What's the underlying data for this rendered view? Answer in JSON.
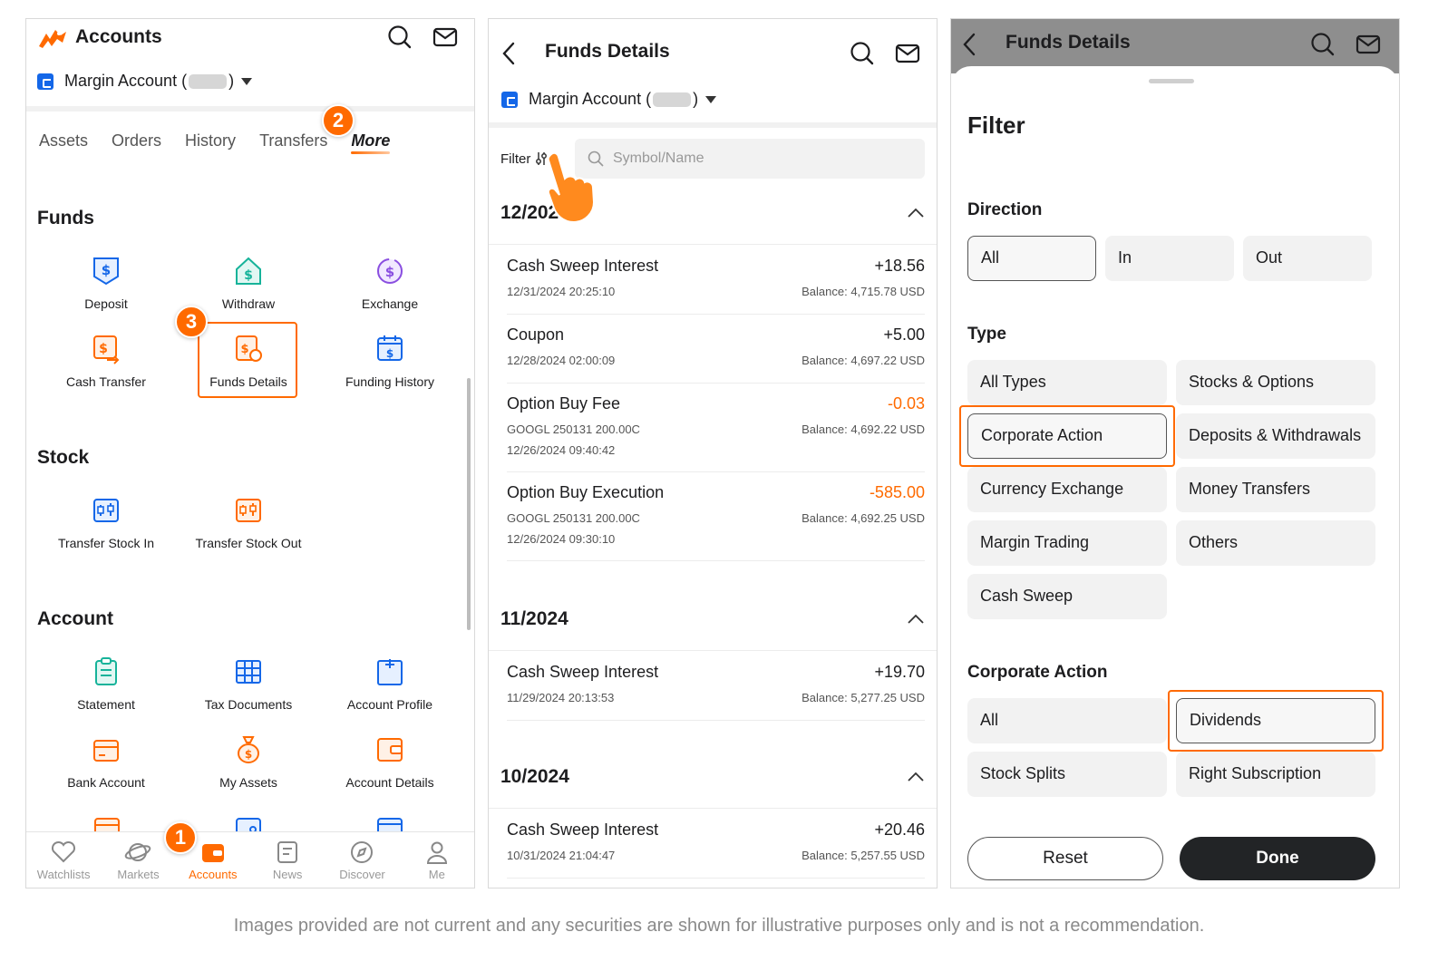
{
  "accounts_screen": {
    "title": "Accounts",
    "account_selector": {
      "label_prefix": "Margin Account (",
      "label_suffix": ")"
    },
    "tabs": [
      "Assets",
      "Orders",
      "History",
      "Transfers",
      "More"
    ],
    "active_tab": "More",
    "funds_section": {
      "title": "Funds",
      "items": [
        "Deposit",
        "Withdraw",
        "Exchange",
        "Cash Transfer",
        "Funds Details",
        "Funding History"
      ]
    },
    "stock_section": {
      "title": "Stock",
      "items": [
        "Transfer Stock In",
        "Transfer Stock Out"
      ]
    },
    "account_section": {
      "title": "Account",
      "items": [
        "Statement",
        "Tax Documents",
        "Account Profile",
        "Bank Account",
        "My Assets",
        "Account Details"
      ]
    },
    "bottom_nav": [
      "Watchlists",
      "Markets",
      "Accounts",
      "News",
      "Discover",
      "Me"
    ],
    "active_nav": "Accounts",
    "steps": {
      "one": "1",
      "two": "2",
      "three": "3"
    }
  },
  "funds_details_screen": {
    "title": "Funds Details",
    "account_selector": {
      "label_prefix": "Margin Account (",
      "label_suffix": ")"
    },
    "filter_label": "Filter",
    "search_placeholder": "Symbol/Name",
    "months": [
      {
        "label": "12/2024",
        "transactions": [
          {
            "name": "Cash Sweep Interest",
            "amount": "+18.56",
            "time": "12/31/2024 20:25:10",
            "balance": "Balance: 4,715.78 USD"
          },
          {
            "name": "Coupon",
            "amount": "+5.00",
            "time": "12/28/2024 02:00:09",
            "balance": "Balance: 4,697.22 USD"
          },
          {
            "name": "Option Buy Fee",
            "amount": "-0.03",
            "symbol": "GOOGL 250131 200.00C",
            "time": "12/26/2024 09:40:42",
            "balance": "Balance: 4,692.22 USD"
          },
          {
            "name": "Option Buy Execution",
            "amount": "-585.00",
            "symbol": "GOOGL 250131 200.00C",
            "time": "12/26/2024 09:30:10",
            "balance": "Balance: 4,692.25 USD"
          }
        ]
      },
      {
        "label": "11/2024",
        "transactions": [
          {
            "name": "Cash Sweep Interest",
            "amount": "+19.70",
            "time": "11/29/2024 20:13:53",
            "balance": "Balance: 5,277.25 USD"
          }
        ]
      },
      {
        "label": "10/2024",
        "transactions": [
          {
            "name": "Cash Sweep Interest",
            "amount": "+20.46",
            "time": "10/31/2024 21:04:47",
            "balance": "Balance: 5,257.55 USD"
          }
        ]
      }
    ]
  },
  "filter_screen": {
    "header_title": "Funds Details",
    "title": "Filter",
    "direction": {
      "title": "Direction",
      "options": [
        "All",
        "In",
        "Out"
      ],
      "selected": "All"
    },
    "type": {
      "title": "Type",
      "options": [
        "All Types",
        "Stocks & Options",
        "Corporate Action",
        "Deposits & Withdrawals",
        "Currency Exchange",
        "Money Transfers",
        "Margin Trading",
        "Others",
        "Cash Sweep"
      ],
      "selected": "Corporate Action"
    },
    "corporate_action": {
      "title": "Corporate Action",
      "options": [
        "All",
        "Dividends",
        "Stock Splits",
        "Right Subscription"
      ],
      "selected": "Dividends"
    },
    "reset_label": "Reset",
    "done_label": "Done"
  },
  "colors": {
    "accent": "#ff6a00",
    "brand_blue": "#1467e8",
    "teal": "#17b39a",
    "purple": "#8a4fe0",
    "dark_button": "#222426"
  },
  "disclaimer": "Images provided are not current and any securities are shown for illustrative purposes only and is not a recommendation."
}
